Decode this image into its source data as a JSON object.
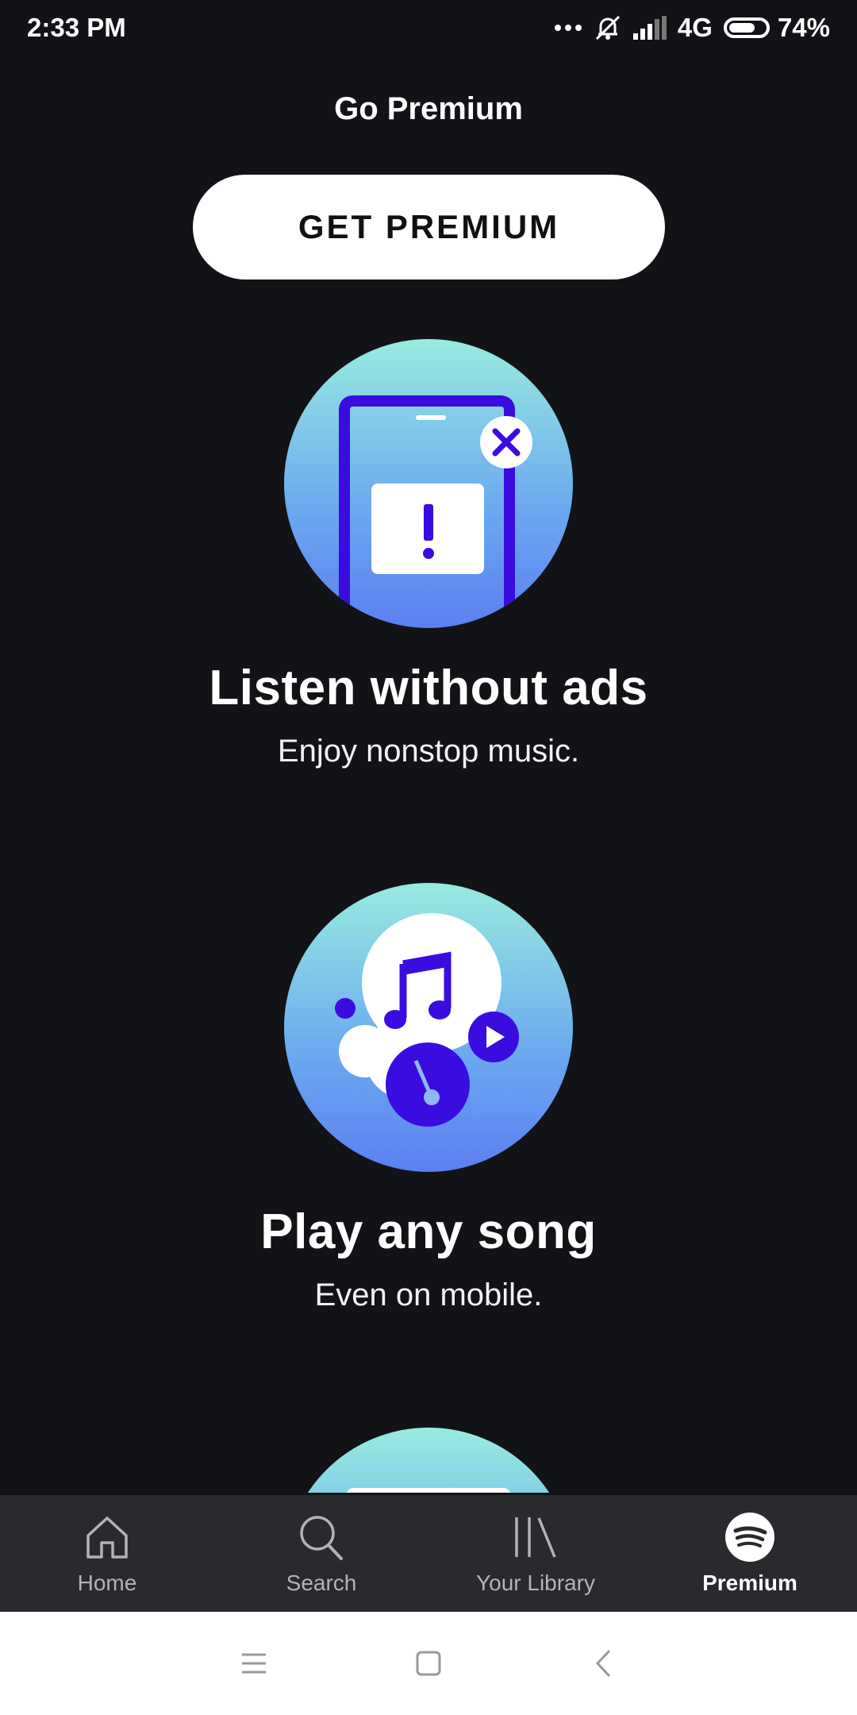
{
  "status_bar": {
    "time": "2:33 PM",
    "network": "4G",
    "battery_percent": "74%",
    "battery_level": 0.74,
    "icons": [
      "more-dots-icon",
      "bell-muted-icon",
      "signal-icon",
      "battery-icon"
    ]
  },
  "header": {
    "title": "Go Premium"
  },
  "cta": {
    "label": "GET PREMIUM"
  },
  "features": [
    {
      "icon": "phone-ad-blocked-icon",
      "title": "Listen without ads",
      "subtitle": "Enjoy nonstop music."
    },
    {
      "icon": "music-play-icon",
      "title": "Play any song",
      "subtitle": "Even on mobile."
    }
  ],
  "bottom_nav": {
    "items": [
      {
        "label": "Home",
        "icon": "home-icon",
        "active": false
      },
      {
        "label": "Search",
        "icon": "search-icon",
        "active": false
      },
      {
        "label": "Your Library",
        "icon": "library-icon",
        "active": false
      },
      {
        "label": "Premium",
        "icon": "spotify-logo-icon",
        "active": true
      }
    ]
  },
  "system_nav": {
    "icons": [
      "menu-icon",
      "home-square-icon",
      "back-icon"
    ]
  },
  "colors": {
    "background": "#121316",
    "nav_background": "#282a2e",
    "illustration_purple": "#3a0ce0",
    "gradient_top": "#98ebe0",
    "gradient_bottom": "#5c7ff2"
  }
}
